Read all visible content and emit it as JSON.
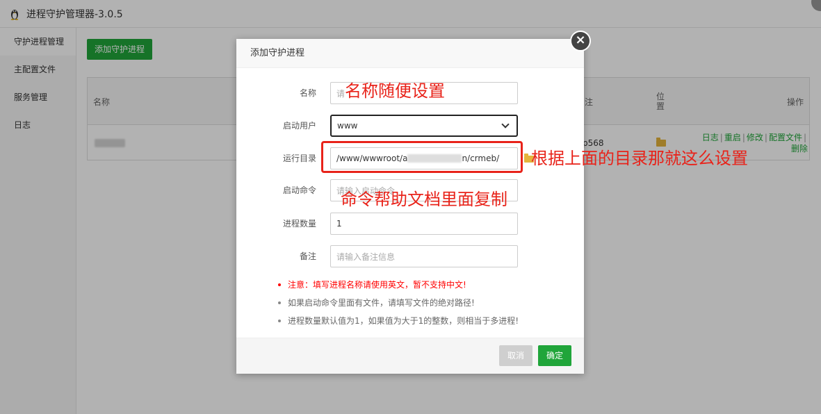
{
  "app": {
    "title": "进程守护管理器-3.0.5"
  },
  "sidebar": {
    "items": [
      {
        "label": "守护进程管理",
        "active": true
      },
      {
        "label": "主配置文件"
      },
      {
        "label": "服务管理"
      },
      {
        "label": "日志"
      }
    ]
  },
  "toolbar": {
    "add_label": "添加守护进程"
  },
  "table": {
    "columns": {
      "name": "名称",
      "remark": "注",
      "location": "位置",
      "actions": "操作"
    },
    "row": {
      "remark_partial": "p568",
      "actions": {
        "log": "日志",
        "restart": "重启",
        "edit": "修改",
        "config": "配置文件",
        "delete": "删除"
      }
    }
  },
  "dialog": {
    "title": "添加守护进程",
    "close_symbol": "×",
    "fields": {
      "name": {
        "label": "名称",
        "placeholder": "请"
      },
      "user": {
        "label": "启动用户",
        "value": "www"
      },
      "dir": {
        "label": "运行目录",
        "value_prefix": "/www/wwwroot/a",
        "value_suffix": "n/crmeb/"
      },
      "command": {
        "label": "启动命令",
        "placeholder": "请输入启动命令"
      },
      "count": {
        "label": "进程数量",
        "value": "1"
      },
      "remark": {
        "label": "备注",
        "placeholder": "请输入备注信息"
      }
    },
    "notes": [
      "注意：填写进程名称请使用英文，暂不支持中文!",
      "如果启动命令里面有文件，请填写文件的绝对路径!",
      "进程数量默认值为1，如果值为大于1的整数，则相当于多进程!"
    ],
    "cancel_label": "取消",
    "confirm_label": "确定"
  },
  "annotations": {
    "name_hint": "名称随便设置",
    "dir_hint": "根据上面的目录那就这么设置",
    "command_hint": "命令帮助文档里面复制"
  },
  "colors": {
    "accent": "#20a53a",
    "annotation": "#e8231a",
    "warning": "#ff0000"
  }
}
